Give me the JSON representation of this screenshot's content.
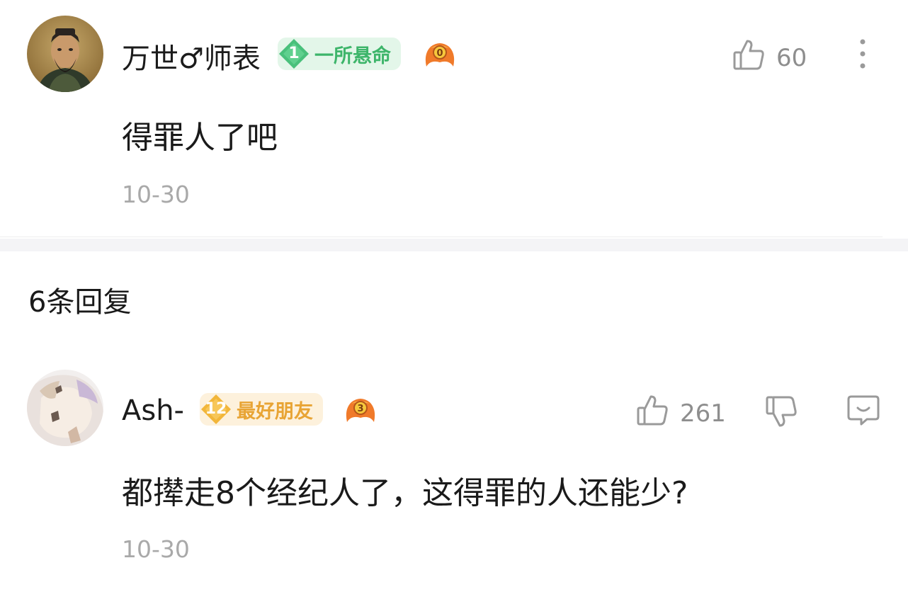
{
  "comment": {
    "username": "万世♂师表",
    "level": "1",
    "badge_label": "一所悬命",
    "text": "得罪人了吧",
    "date": "10-30",
    "likes": "60",
    "mascot_number": "0",
    "icons": {
      "avatar": "confucius-portrait",
      "like": "thumbs-up-icon",
      "more": "more-vertical-icon"
    },
    "badge_color": "#3db56a"
  },
  "replies_header": {
    "label": "6条回复"
  },
  "reply": {
    "username": "Ash-",
    "level": "12",
    "badge_label": "最好朋友",
    "text": "都撵走8个经纪人了，这得罪的人还能少?",
    "date": "10-30",
    "likes": "261",
    "mascot_number": "3",
    "icons": {
      "like": "thumbs-up-icon",
      "dislike": "thumbs-down-icon",
      "reply": "reply-bubble-icon"
    },
    "badge_color": "#e8a434"
  }
}
